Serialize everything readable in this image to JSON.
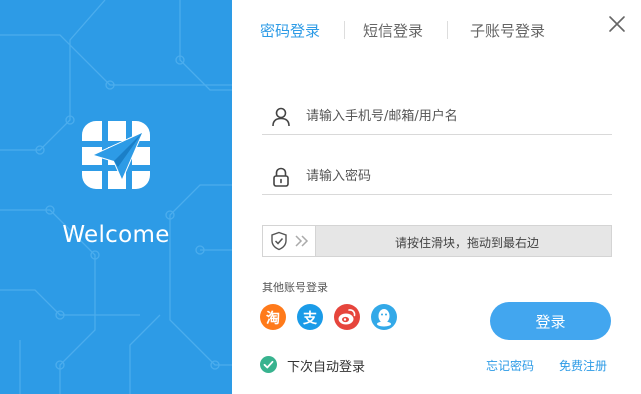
{
  "brand": {
    "welcome_text": "Welcome",
    "panel_color": "#2d9be6"
  },
  "tabs": [
    {
      "label": "密码登录",
      "active": true
    },
    {
      "label": "短信登录",
      "active": false
    },
    {
      "label": "子账号登录",
      "active": false
    }
  ],
  "form": {
    "username_placeholder": "请输入手机号/邮箱/用户名",
    "password_placeholder": "请输入密码",
    "slider_text": "请按住滑块，拖动到最右边",
    "other_accounts_label": "其他账号登录",
    "login_button": "登录",
    "auto_login_label": "下次自动登录",
    "auto_login_checked": true,
    "forgot_password": "忘记密码",
    "register": "免费注册"
  },
  "social": [
    {
      "name": "taobao",
      "glyph": "淘",
      "color": "#ff7a1a"
    },
    {
      "name": "alipay",
      "glyph": "支",
      "color": "#1a9be8"
    },
    {
      "name": "weibo",
      "glyph": "微",
      "color": "#e6453c"
    },
    {
      "name": "qq",
      "glyph": "",
      "color": "#33a9e8"
    }
  ],
  "icons": {
    "close": "close-icon",
    "user": "user-icon",
    "lock": "lock-icon",
    "shield": "shield-check-icon",
    "arrows": "double-chevron-right-icon",
    "check": "check-icon"
  }
}
